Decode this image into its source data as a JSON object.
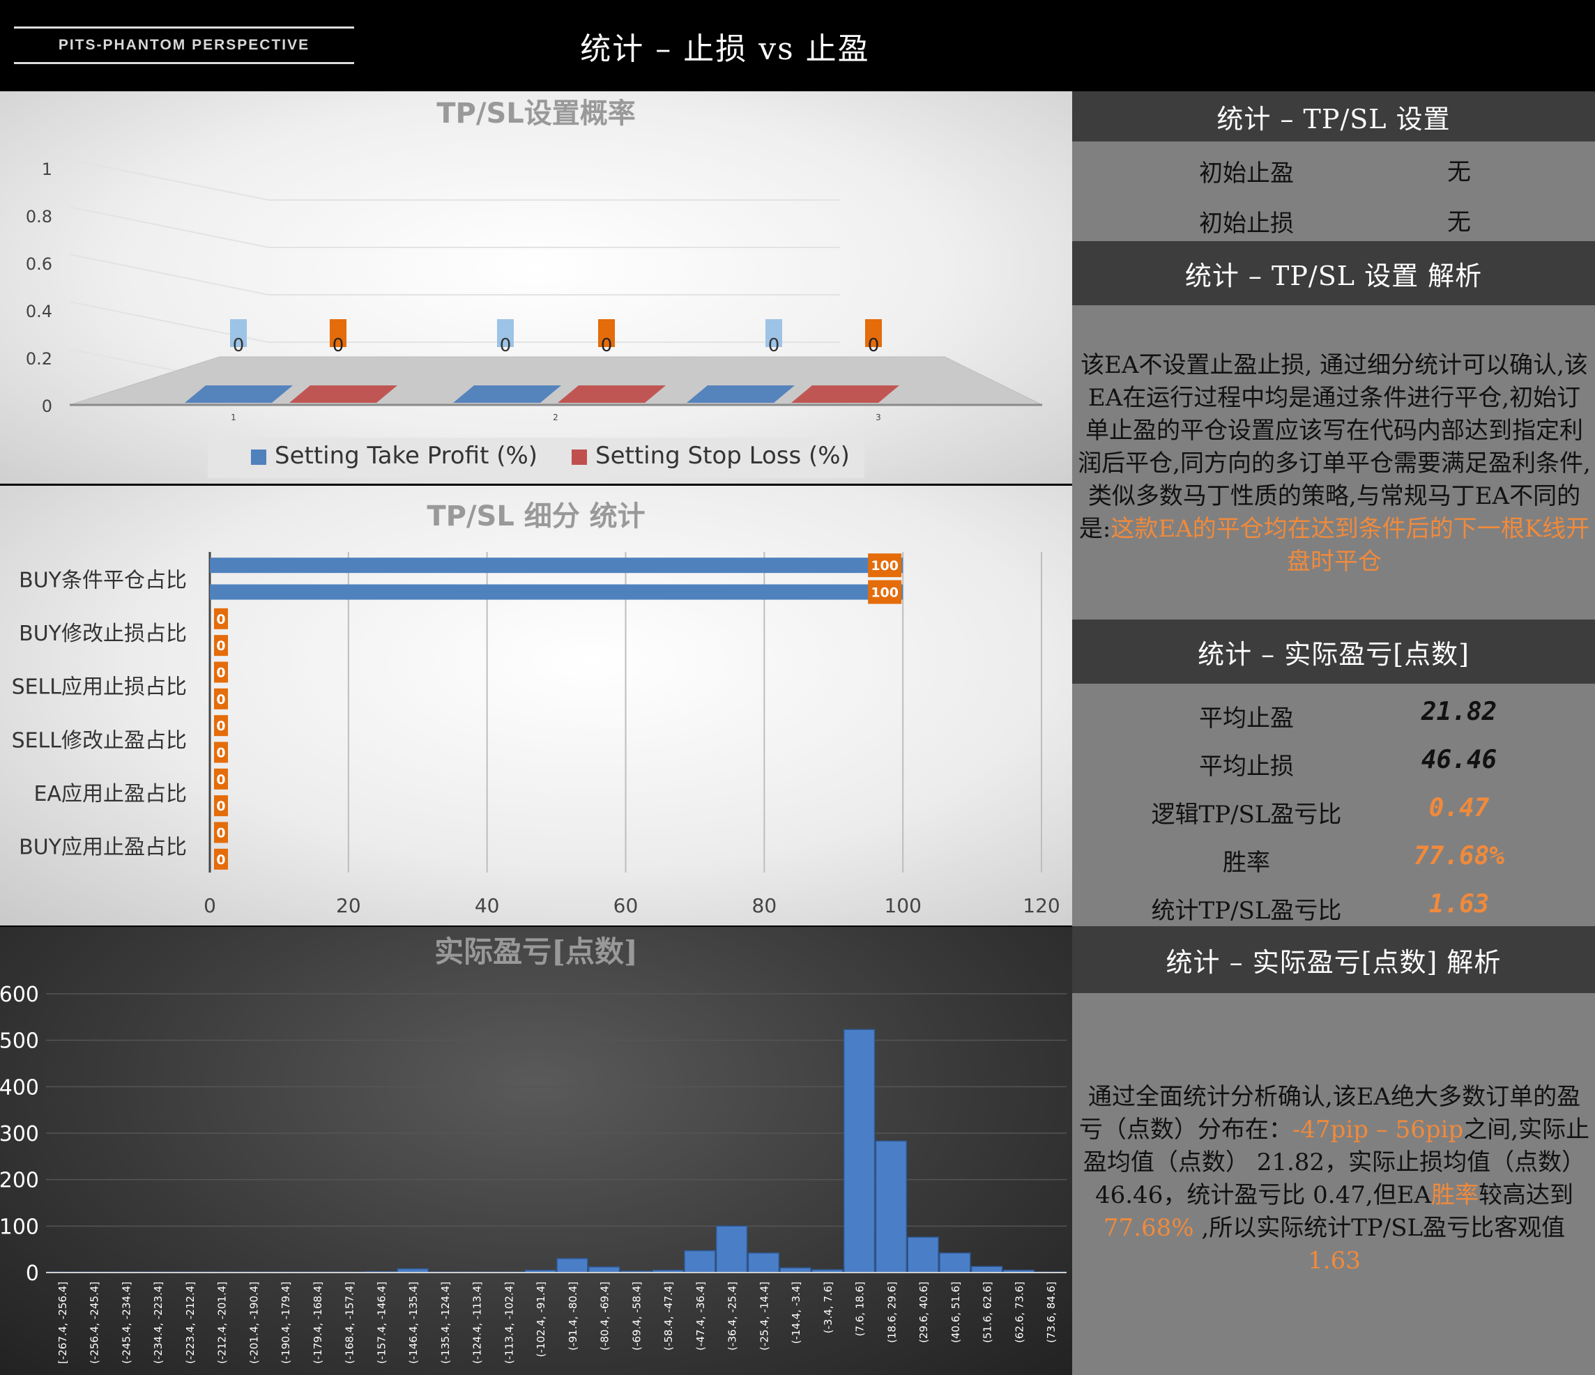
{
  "header": {
    "logo_text": "PITS-PHANTOM PERSPECTIVE",
    "title": "统计 – 止损 vs 止盈"
  },
  "right_panel": {
    "setting_title": "统计 – TP/SL 设置",
    "setting_rows": [
      {
        "label": "初始止盈",
        "value": "无"
      },
      {
        "label": "初始止损",
        "value": "无"
      }
    ],
    "setting_analysis_title": "统计 – TP/SL 设置 解析",
    "setting_analysis_text": "该EA不设置止盈止损, 通过细分统计可以确认,该EA在运行过程中均是通过条件进行平仓,初始订单止盈的平仓设置应该写在代码内部达到指定利润后平仓,同方向的多订单平仓需要满足盈利条件,类似多数马丁性质的策略,与常规马丁EA不同的是:",
    "setting_analysis_highlight": "这款EA的平仓均在达到条件后的下一根K线开盘时平仓",
    "pnl_title": "统计 – 实际盈亏[点数]",
    "pnl_rows": [
      {
        "label": "平均止盈",
        "value": "21.82",
        "color": "#111111"
      },
      {
        "label": "平均止损",
        "value": "46.46",
        "color": "#111111"
      },
      {
        "label": "逻辑TP/SL盈亏比",
        "value": "0.47",
        "color": "#f08a3c"
      },
      {
        "label": "胜率",
        "value": "77.68%",
        "color": "#f08a3c"
      },
      {
        "label": "统计TP/SL盈亏比",
        "value": "1.63",
        "color": "#f08a3c"
      }
    ],
    "pnl_analysis_title": "统计 – 实际盈亏[点数] 解析",
    "pnl_analysis_parts": [
      {
        "text": "通过全面统计分析确认,该EA绝大多数订单的盈亏（点数）分布在：",
        "hl": false
      },
      {
        "text": "-47pip – 56pip",
        "hl": true
      },
      {
        "text": "之间,实际止盈均值（点数） 21.82，实际止损均值（点数） 46.46，统计盈亏比 0.47,但EA",
        "hl": false
      },
      {
        "text": "胜率",
        "hl": true
      },
      {
        "text": "较高达到",
        "hl": false
      },
      {
        "text": "77.68%",
        "hl": true
      },
      {
        "text": " ,所以实际统计TP/SL盈亏比客观值",
        "hl": false
      },
      {
        "text": "1.63",
        "hl": true
      }
    ]
  },
  "chart_data": [
    {
      "type": "bar",
      "title": "TP/SL设置概率",
      "categories": [
        "1",
        "2",
        "3"
      ],
      "series": [
        {
          "name": "Setting Take Profit (%)",
          "values": [
            0,
            0,
            0
          ],
          "color": "#4f81bd"
        },
        {
          "name": "Setting Stop Loss (%)",
          "values": [
            0,
            0,
            0
          ],
          "color": "#c0504d"
        }
      ],
      "yticks": [
        "0",
        "0.2",
        "0.4",
        "0.6",
        "0.8",
        "1"
      ],
      "ylim": [
        0,
        1
      ],
      "legend": "bottom"
    },
    {
      "type": "bar",
      "orientation": "horizontal",
      "title": "TP/SL 细分 统计",
      "category_labels": [
        "BUY条件平仓占比",
        "BUY修改止损占比",
        "SELL应用止损占比",
        "SELL修改止盈占比",
        "EA应用止盈占比",
        "BUY应用止盈占比"
      ],
      "values": [
        100,
        100,
        0,
        0,
        0,
        0,
        0,
        0,
        0,
        0,
        0,
        0
      ],
      "xticks": [
        "0",
        "20",
        "40",
        "60",
        "80",
        "100",
        "120"
      ],
      "xlim": [
        0,
        120
      ],
      "bar_color": "#4f81bd",
      "label_color": "#e46c0a"
    },
    {
      "type": "bar",
      "title": "实际盈亏[点数]",
      "categories": [
        "[-267.4, -256.4]",
        "(-256.4, -245.4]",
        "(-245.4, -234.4]",
        "(-234.4, -223.4]",
        "(-223.4, -212.4]",
        "(-212.4, -201.4]",
        "(-201.4, -190.4]",
        "(-190.4, -179.4]",
        "(-179.4, -168.4]",
        "(-168.4, -157.4]",
        "(-157.4, -146.4]",
        "(-146.4, -135.4]",
        "(-135.4, -124.4]",
        "(-124.4, -113.4]",
        "(-113.4, -102.4]",
        "(-102.4, -91.4]",
        "(-91.4, -80.4]",
        "(-80.4, -69.4]",
        "(-69.4, -58.4]",
        "(-58.4, -47.4]",
        "(-47.4, -36.4]",
        "(-36.4, -25.4]",
        "(-25.4, -14.4]",
        "(-14.4, -3.4]",
        "(-3.4, 7.6]",
        "(7.6, 18.6]",
        "(18.6, 29.6]",
        "(29.6, 40.6]",
        "(40.6, 51.6]",
        "(51.6, 62.6]",
        "(62.6, 73.6]",
        "(73.6, 84.6]"
      ],
      "values": [
        1,
        1,
        1,
        1,
        1,
        1,
        1,
        1,
        1,
        1,
        2,
        8,
        1,
        1,
        1,
        5,
        30,
        12,
        3,
        5,
        47,
        100,
        42,
        10,
        6,
        523,
        283,
        76,
        42,
        13,
        5,
        1
      ],
      "yticks": [
        "0",
        "100",
        "200",
        "300",
        "400",
        "500",
        "600"
      ],
      "ylim": [
        0,
        600
      ],
      "bar_color": "#4a7fc8"
    }
  ]
}
